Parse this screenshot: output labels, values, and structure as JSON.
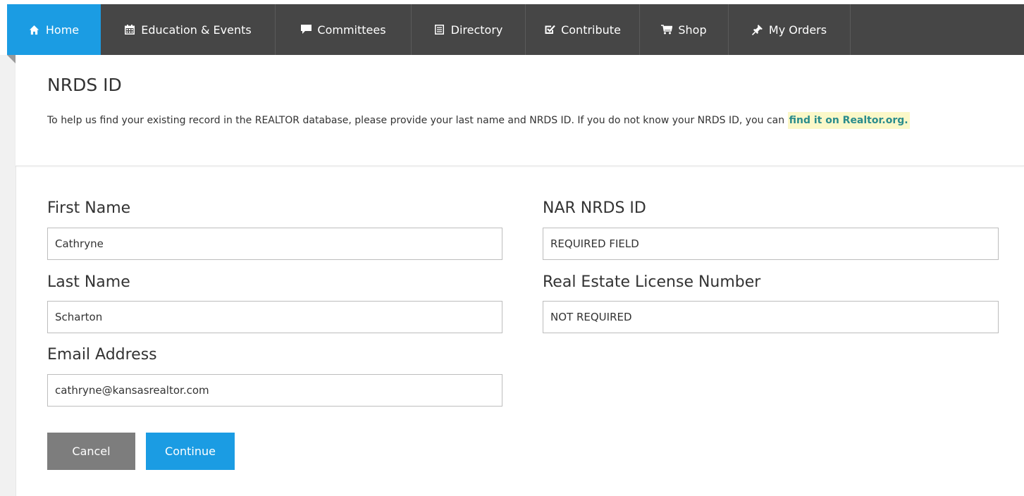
{
  "nav": {
    "items": [
      {
        "label": "Home",
        "icon": "home-icon"
      },
      {
        "label": "Education & Events",
        "icon": "calendar-icon"
      },
      {
        "label": "Committees",
        "icon": "speech-bubble-icon"
      },
      {
        "label": "Directory",
        "icon": "list-icon"
      },
      {
        "label": "Contribute",
        "icon": "checkbox-icon"
      },
      {
        "label": "Shop",
        "icon": "cart-icon"
      },
      {
        "label": "My Orders",
        "icon": "pin-icon"
      }
    ],
    "active_color": "#1b9ce3",
    "bar_color": "#464646"
  },
  "header": {
    "title": "NRDS ID",
    "intro_text": "To help us find your existing record in the REALTOR database, please provide your last name and NRDS ID. If you do not know your NRDS ID, you can ",
    "link_text": "find it on Realtor.org",
    "intro_end": "."
  },
  "form": {
    "first_name": {
      "label": "First Name",
      "value": "Cathryne"
    },
    "last_name": {
      "label": "Last Name",
      "value": "Scharton"
    },
    "email": {
      "label": "Email Address",
      "value": "cathryne@kansasrealtor.com"
    },
    "nrds_id": {
      "label": "NAR NRDS ID",
      "placeholder": "REQUIRED FIELD"
    },
    "license": {
      "label": "Real Estate License Number",
      "placeholder": "NOT REQUIRED"
    }
  },
  "buttons": {
    "cancel": "Cancel",
    "continue": "Continue"
  }
}
